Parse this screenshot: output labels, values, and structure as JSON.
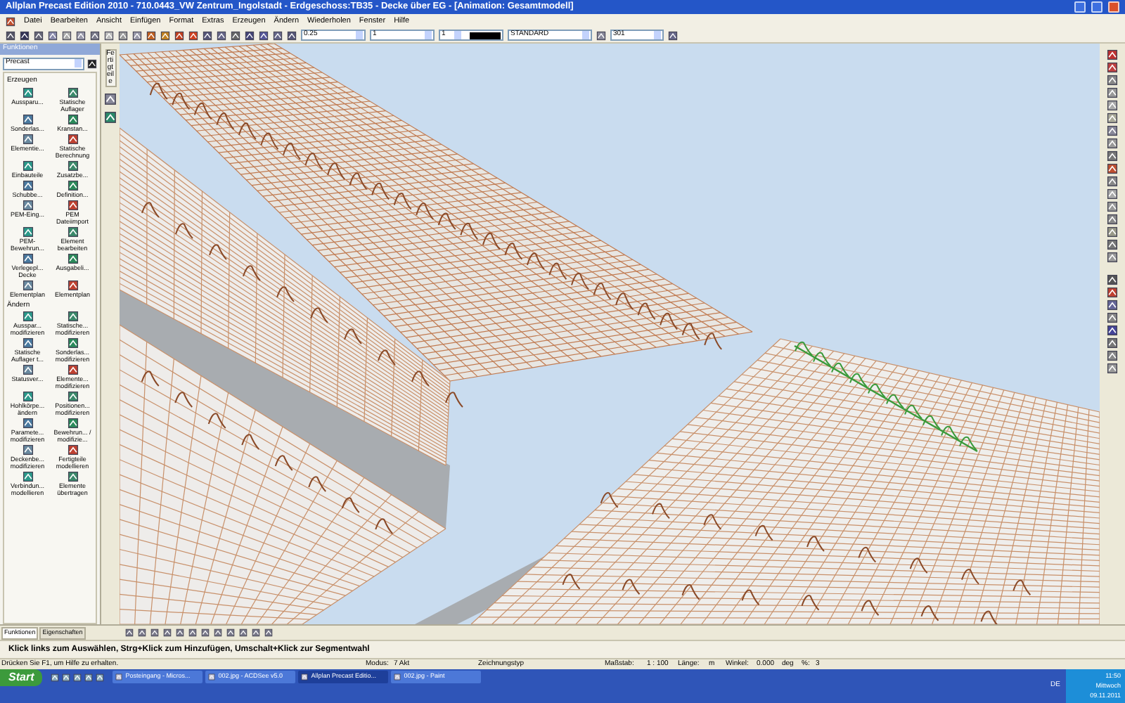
{
  "window": {
    "title": "Allplan Precast Edition 2010 - 710.0443_VW Zentrum_Ingolstadt - Erdgeschoss:TB35 - Decke über EG - [Animation: Gesamtmodell]"
  },
  "menu": [
    "Datei",
    "Bearbeiten",
    "Ansicht",
    "Einfügen",
    "Format",
    "Extras",
    "Erzeugen",
    "Ändern",
    "Wiederholen",
    "Fenster",
    "Hilfe"
  ],
  "toolbar": {
    "pen": "0.25",
    "line": "1",
    "color_index": "1",
    "layer": "STANDARD",
    "format": "301"
  },
  "panel": {
    "title": "Funktionen",
    "module": "Precast",
    "side_tab": "Fertigteile",
    "sections": [
      {
        "title": "Erzeugen",
        "items": [
          "Aussparu...",
          "Statische Auflager",
          "Sonderlas...",
          "Kranstan...",
          "Elementie...",
          "Statische Berechnung",
          "Einbauteile",
          "Zusatzbe...",
          "Schubbe...",
          "Definition...",
          "PEM-Eing...",
          "PEM Dateiimport",
          "PEM-Bewehrun...",
          "Element bearbeiten",
          "Verlegepl... Decke",
          "Ausgabeli...",
          "Elementplan",
          "Elementplan"
        ]
      },
      {
        "title": "Ändern",
        "items": [
          "Ausspar... modifizieren",
          "Statische... modifizieren",
          "Statische Auflager t...",
          "Sonderlas... modifizieren",
          "Statusver...",
          "Elemente... modifizieren",
          "Hohlkörpe... ändern",
          "Positionen... modifizieren",
          "Paramete... modifizieren",
          "Bewehrun... / modifizie...",
          "Deckenbe... modifizieren",
          "Fertigteile modellieren",
          "Verbindun... modellieren",
          "Elemente übertragen"
        ]
      }
    ],
    "tabs": [
      {
        "label": "Funktionen",
        "selected": true
      },
      {
        "label": "Eigenschaften",
        "selected": false
      }
    ]
  },
  "hint": "Klick links zum Auswählen, Strg+Klick zum Hinzufügen, Umschalt+Klick zur Segmentwahl",
  "status_bar": {
    "help": "Drücken Sie F1, um Hilfe zu erhalten.",
    "fields": [
      "Modus:",
      "7 Akt",
      "Zeichnungstyp",
      "Maßstab:",
      "1 : 100",
      "Länge:",
      "m",
      "Winkel:",
      "0.000",
      "deg",
      "%:",
      "3"
    ]
  },
  "taskbar": {
    "start": "Start",
    "tasks": [
      {
        "label": "Posteingang - Micros...",
        "selected": false
      },
      {
        "label": "002.jpg - ACDSee v5.0",
        "selected": false
      },
      {
        "label": "Allplan Precast Editio...",
        "selected": true
      },
      {
        "label": "002.jpg - Paint",
        "selected": false
      }
    ],
    "language": "DE",
    "time": "11:50",
    "day": "Mittwoch",
    "date": "09.11.2011"
  }
}
